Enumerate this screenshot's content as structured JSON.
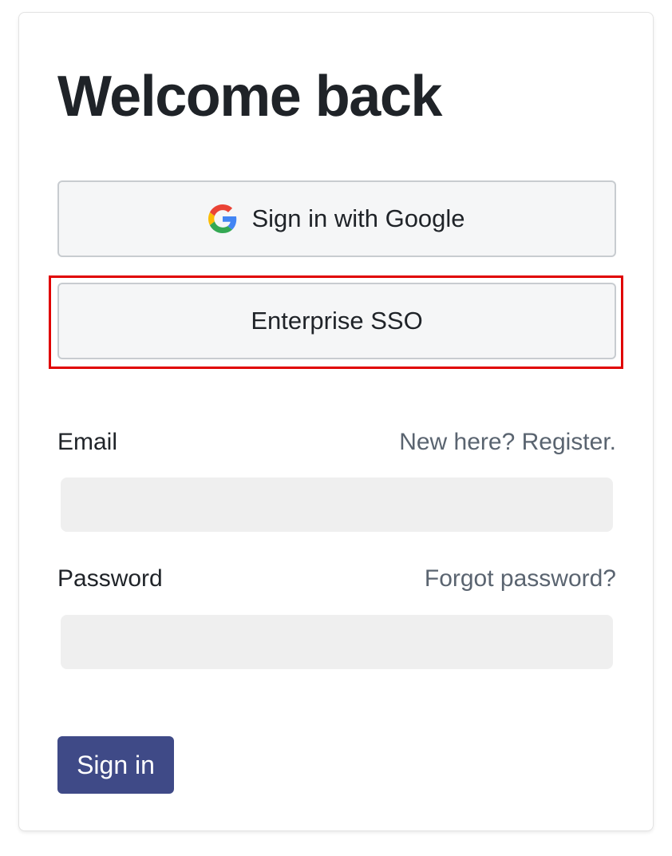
{
  "page": {
    "title": "Welcome back"
  },
  "auth": {
    "google_button_label": "Sign in with Google",
    "google_icon": "google-g-logo",
    "sso_button_label": "Enterprise SSO"
  },
  "form": {
    "email_label": "Email",
    "register_link": "New here? Register.",
    "email_value": "",
    "password_label": "Password",
    "forgot_link": "Forgot password?",
    "password_value": "",
    "submit_label": "Sign in"
  },
  "colors": {
    "primary": "#3f4a87",
    "highlight": "#e00000",
    "link": "#5a6470",
    "input_bg": "#efefef"
  }
}
